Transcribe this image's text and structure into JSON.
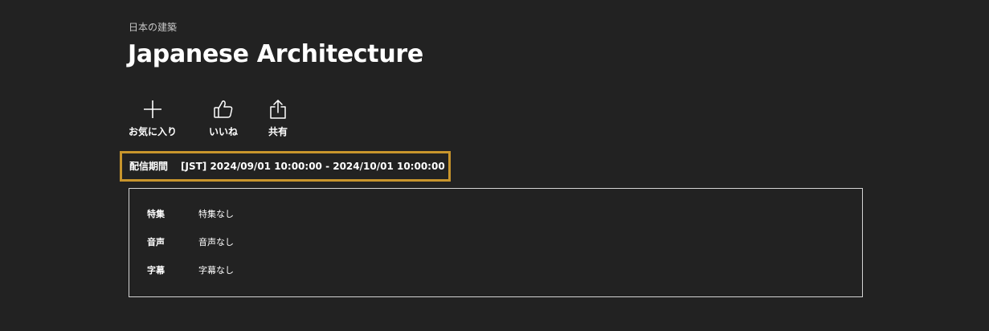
{
  "header": {
    "subtitle": "日本の建築",
    "title": "Japanese Architecture"
  },
  "actions": [
    {
      "label": "お気に入り",
      "icon": "plus-icon"
    },
    {
      "label": "いいね",
      "icon": "thumbs-up-icon"
    },
    {
      "label": "共有",
      "icon": "share-icon"
    }
  ],
  "period": {
    "label": "配信期間",
    "value": "[JST] 2024/09/01 10:00:00 - 2024/10/01 10:00:00",
    "highlight_color": "#c8952c"
  },
  "details": [
    {
      "key": "特集",
      "value": "特集なし"
    },
    {
      "key": "音声",
      "value": "音声なし"
    },
    {
      "key": "字幕",
      "value": "字幕なし"
    }
  ]
}
